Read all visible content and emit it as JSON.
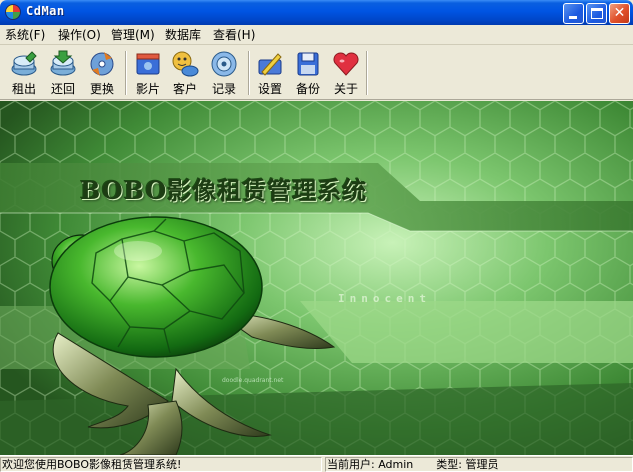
{
  "window": {
    "title": "CdMan"
  },
  "titlebar": {
    "close_glyph": "✕"
  },
  "menu": [
    {
      "label": "系统(F)"
    },
    {
      "label": "操作(O)"
    },
    {
      "label": "管理(M)"
    },
    {
      "label": "数据库"
    },
    {
      "label": "查看(H)"
    }
  ],
  "toolbar": {
    "groups": [
      [
        {
          "label": "租出",
          "icon": "rent-out-icon"
        },
        {
          "label": "还回",
          "icon": "return-icon"
        },
        {
          "label": "更换",
          "icon": "exchange-icon"
        }
      ],
      [
        {
          "label": "影片",
          "icon": "movie-icon"
        },
        {
          "label": "客户",
          "icon": "customer-icon"
        },
        {
          "label": "记录",
          "icon": "record-icon"
        }
      ],
      [
        {
          "label": "设置",
          "icon": "settings-icon"
        },
        {
          "label": "备份",
          "icon": "backup-icon"
        },
        {
          "label": "关于",
          "icon": "about-icon"
        }
      ]
    ]
  },
  "splash": {
    "title": "BOBO影像租赁管理系统",
    "decor_text": "Innocent",
    "credit": "doodle.quadrant.net"
  },
  "status": {
    "welcome": "欢迎您使用BOBO影像租赁管理系统!",
    "user_label": "当前用户:",
    "user_value": "Admin",
    "type_label": "类型:",
    "type_value": "管理员"
  },
  "colors": {
    "title_bar": "#0054e3",
    "splash_green": "#2f6a2a",
    "window_face": "#ece9d8"
  }
}
